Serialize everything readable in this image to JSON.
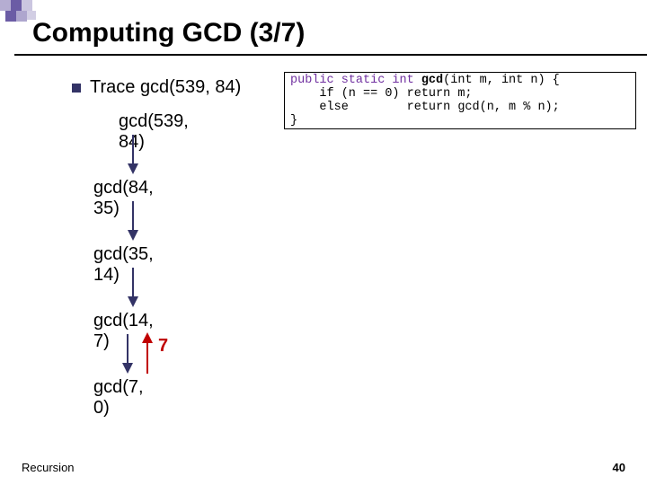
{
  "title": "Computing GCD (3/7)",
  "bullet_text": "Trace gcd(539, 84)",
  "code": {
    "l1a": "public static int ",
    "l1b": "gcd",
    "l1c": "(int m, int n) {",
    "l2a": "    if (n == 0) return m;",
    "l3a": "    else        return gcd(n, m % n);",
    "l4a": "}"
  },
  "calls": [
    "gcd(539, 84)",
    "gcd(84, 35)",
    "gcd(35, 14)",
    "gcd(14, 7)",
    "gcd(7, 0)"
  ],
  "return_value": "7",
  "footer_left": "Recursion",
  "footer_right": "40",
  "colors": {
    "accent": "#6b5ca5",
    "red": "#c00000"
  }
}
